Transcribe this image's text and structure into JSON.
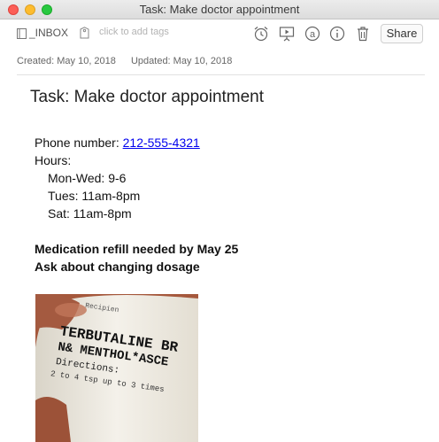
{
  "window": {
    "title": "Task: Make doctor appointment"
  },
  "toolbar": {
    "notebook": "_INBOX",
    "tag_placeholder": "click to add tags",
    "share_label": "Share",
    "icons": [
      "reminder-alarm-icon",
      "presentation-icon",
      "at-icon",
      "info-icon",
      "trash-icon"
    ]
  },
  "meta": {
    "created": "Created: May 10, 2018",
    "updated": "Updated: May 10, 2018"
  },
  "note": {
    "title": "Task: Make doctor appointment",
    "phone_label": "Phone number: ",
    "phone_link": "212-555-4321",
    "hours_label": "Hours:",
    "hours": [
      "Mon-Wed: 9-6",
      "Tues: 11am-8pm",
      "Sat: 11am-8pm"
    ],
    "emphasis": [
      "Medication refill needed by May 25",
      "Ask about changing dosage"
    ],
    "image": {
      "label_line1": "TERBUTALINE BR",
      "label_line2": "N& MENTHOL*ASCE",
      "header_text": "Recipien",
      "directions": "Directions:",
      "directions_text": "2 to 4 tsp up to 3 times"
    }
  }
}
